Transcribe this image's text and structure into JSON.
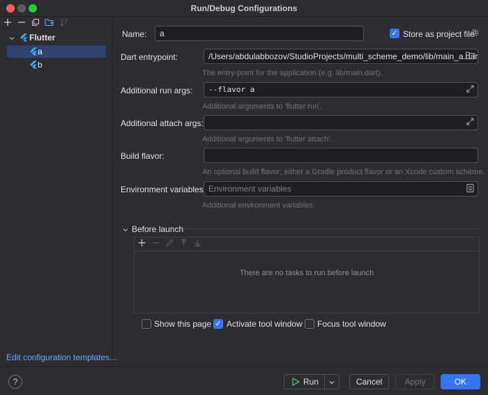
{
  "window": {
    "title": "Run/Debug Configurations"
  },
  "sidebar": {
    "tree": {
      "group_label": "Flutter",
      "items": [
        {
          "label": "a",
          "selected": true
        },
        {
          "label": "b",
          "selected": false
        }
      ]
    },
    "footer_link": "Edit configuration templates..."
  },
  "form": {
    "name": {
      "label": "Name:",
      "value": "a"
    },
    "store_as_project_file": {
      "label": "Store as project file",
      "checked": true
    },
    "dart_entrypoint": {
      "label": "Dart entrypoint:",
      "value": "/Users/abdulabbozov/StudioProjects/multi_scheme_demo/lib/main_a.dart",
      "hint": "The entry-point for the application (e.g. lib/main.dart)."
    },
    "run_args": {
      "label": "Additional run args:",
      "value": "--flavor a",
      "hint": "Additional arguments to 'flutter run'."
    },
    "attach_args": {
      "label": "Additional attach args:",
      "value": "",
      "hint": "Additional arguments to 'flutter attach'."
    },
    "build_flavor": {
      "label": "Build flavor:",
      "value": "",
      "hint": "An optional build flavor; either a Gradle product flavor or an Xcode custom scheme."
    },
    "env_vars": {
      "label": "Environment variables:",
      "placeholder": "Environment variables",
      "hint": "Additional environment variables."
    }
  },
  "before_launch": {
    "title": "Before launch",
    "empty_text": "There are no tasks to run before launch",
    "options": [
      {
        "label": "Show this page",
        "checked": false
      },
      {
        "label": "Activate tool window",
        "checked": true
      },
      {
        "label": "Focus tool window",
        "checked": false
      }
    ]
  },
  "buttons": {
    "run": "Run",
    "cancel": "Cancel",
    "apply": "Apply",
    "ok": "OK",
    "help": "?"
  },
  "colors": {
    "accent": "#3574f0",
    "selection": "#2e436e",
    "link": "#6fa5ff",
    "flutter_blue": "#42a5f5",
    "run_green": "#5fb865"
  },
  "icons": {
    "toolbar": [
      "plus-icon",
      "minus-icon",
      "copy-icon",
      "new-folder-icon",
      "sort-icon"
    ],
    "flutter": "flutter-icon",
    "folder": "folder-icon",
    "expand": "expand-icon",
    "settings": "gear-icon"
  }
}
